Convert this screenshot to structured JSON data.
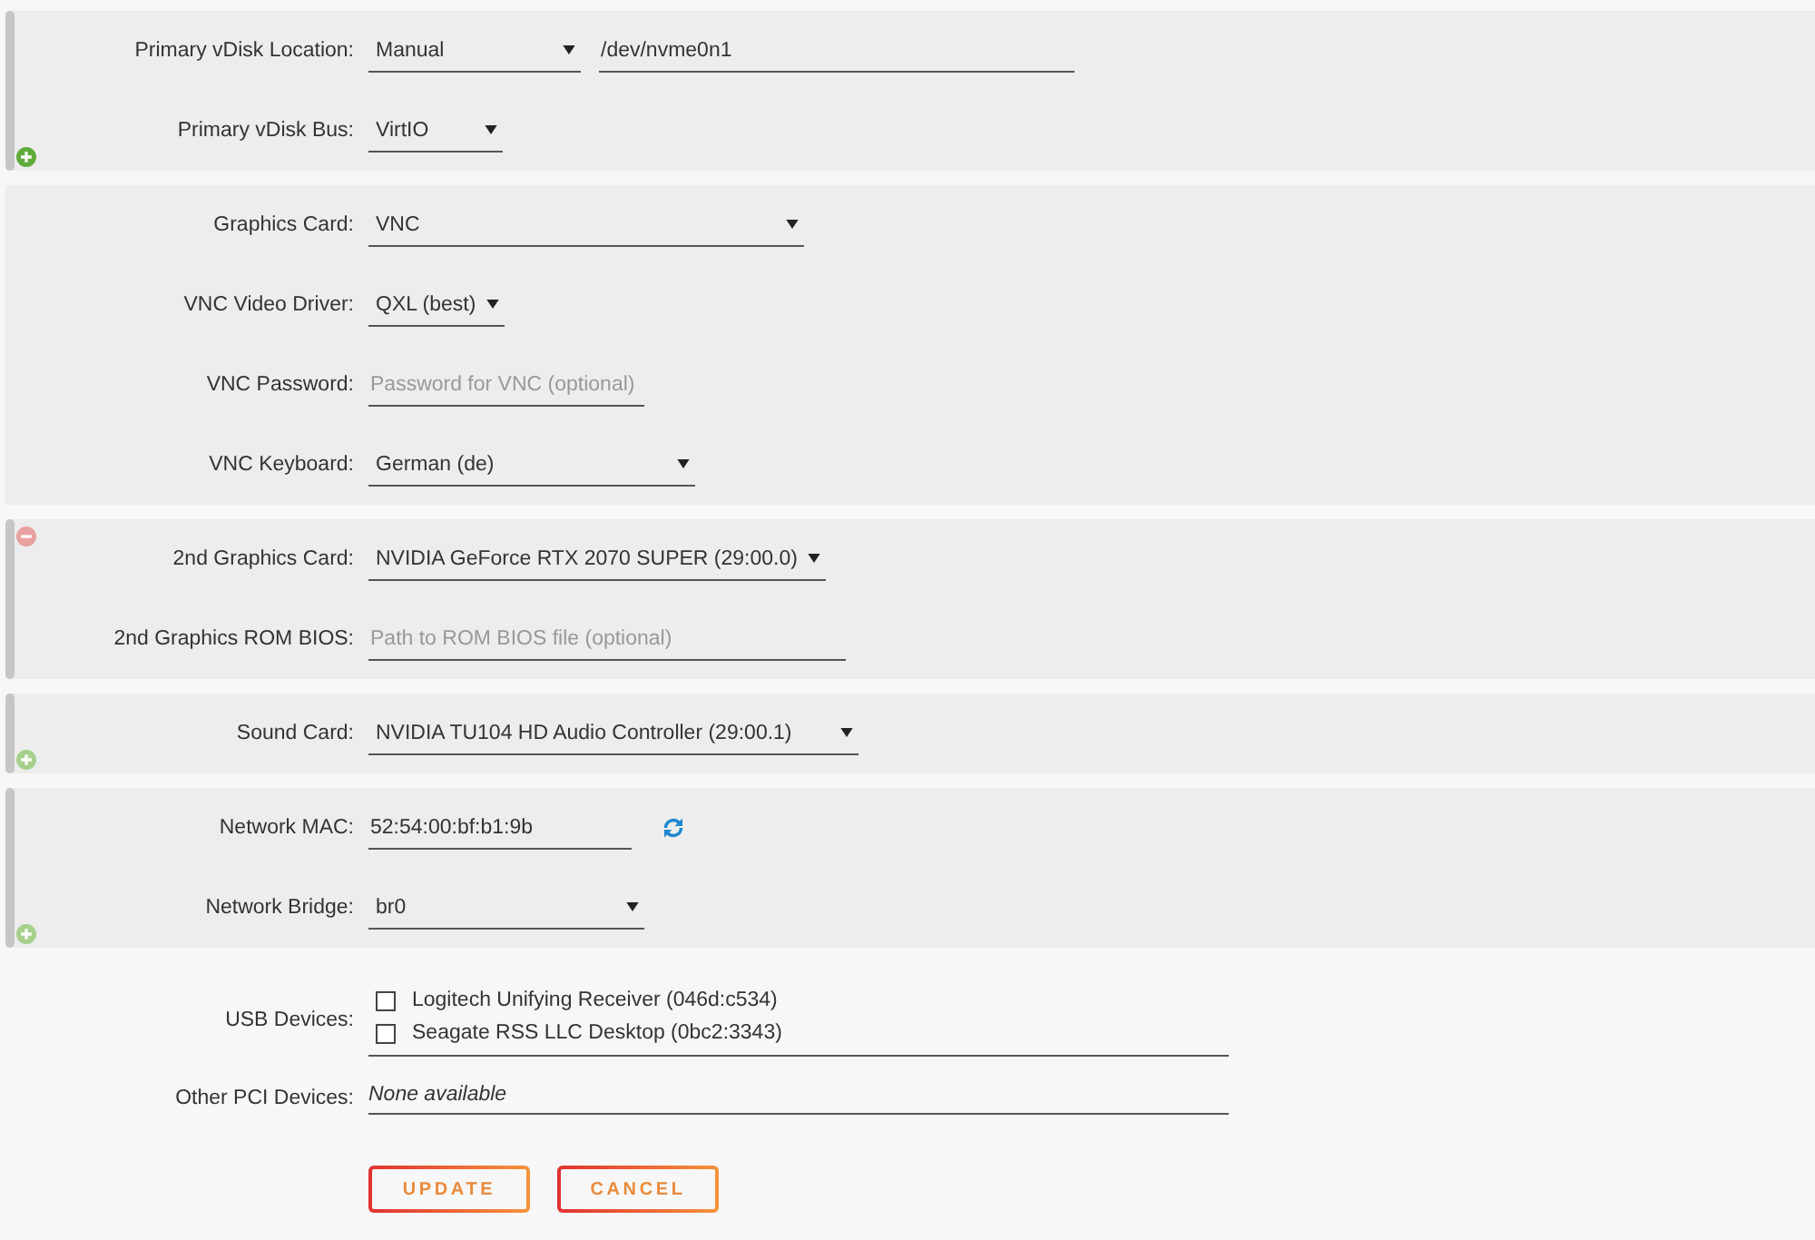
{
  "sections": [
    {
      "panel": true,
      "bar": true,
      "action": {
        "kind": "add",
        "dimmed": false
      },
      "fields": [
        {
          "label": "Primary vDisk Location:",
          "controls": [
            {
              "kind": "select",
              "value": "Manual"
            },
            {
              "kind": "text",
              "value": "/dev/nvme0n1"
            }
          ]
        },
        {
          "label": "Primary vDisk Bus:",
          "controls": [
            {
              "kind": "select",
              "value": "VirtIO"
            }
          ]
        }
      ]
    },
    {
      "panel": true,
      "bar": false,
      "fields": [
        {
          "label": "Graphics Card:",
          "controls": [
            {
              "kind": "select",
              "value": "VNC"
            }
          ]
        },
        {
          "label": "VNC Video Driver:",
          "controls": [
            {
              "kind": "select",
              "value": "QXL (best)"
            }
          ]
        },
        {
          "label": "VNC Password:",
          "controls": [
            {
              "kind": "text",
              "placeholder": "Password for VNC (optional)"
            }
          ]
        },
        {
          "label": "VNC Keyboard:",
          "controls": [
            {
              "kind": "select",
              "value": "German (de)"
            }
          ]
        }
      ]
    },
    {
      "panel": true,
      "bar": true,
      "action": {
        "kind": "remove",
        "dimmed": true
      },
      "fields": [
        {
          "label": "2nd Graphics Card:",
          "controls": [
            {
              "kind": "select",
              "value": "NVIDIA GeForce RTX 2070 SUPER (29:00.0)"
            }
          ]
        },
        {
          "label": "2nd Graphics ROM BIOS:",
          "controls": [
            {
              "kind": "text",
              "placeholder": "Path to ROM BIOS file (optional)"
            }
          ]
        }
      ]
    },
    {
      "panel": true,
      "bar": true,
      "action": {
        "kind": "add",
        "dimmed": true
      },
      "fields": [
        {
          "label": "Sound Card:",
          "controls": [
            {
              "kind": "select",
              "value": "NVIDIA TU104 HD Audio Controller (29:00.1)"
            }
          ]
        }
      ]
    },
    {
      "panel": true,
      "bar": true,
      "action": {
        "kind": "add",
        "dimmed": true
      },
      "fields": [
        {
          "label": "Network MAC:",
          "controls": [
            {
              "kind": "text",
              "value": "52:54:00:bf:b1:9b"
            },
            {
              "kind": "refresh"
            }
          ]
        },
        {
          "label": "Network Bridge:",
          "controls": [
            {
              "kind": "select",
              "value": "br0"
            }
          ]
        }
      ]
    },
    {
      "panel": false,
      "fields": [
        {
          "label": "USB Devices:",
          "controls": [
            {
              "kind": "checklist",
              "items": [
                {
                  "label": "Logitech Unifying Receiver (046d:c534)",
                  "checked": false
                },
                {
                  "label": "Seagate RSS LLC Desktop (0bc2:3343)",
                  "checked": false
                }
              ]
            }
          ]
        },
        {
          "label": "Other PCI Devices:",
          "controls": [
            {
              "kind": "note",
              "value": "None available"
            }
          ]
        }
      ]
    }
  ],
  "buttons": [
    {
      "label": "UPDATE"
    },
    {
      "label": "CANCEL"
    }
  ]
}
